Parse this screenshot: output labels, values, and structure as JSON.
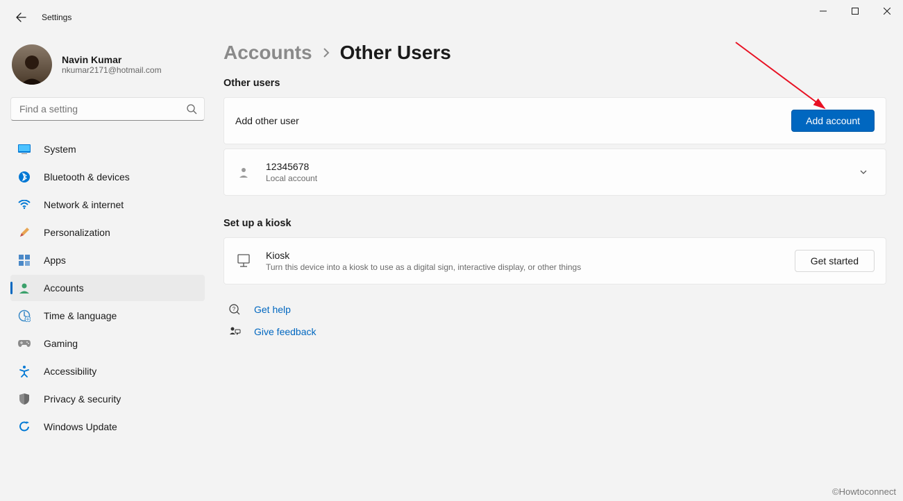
{
  "window": {
    "title": "Settings"
  },
  "user": {
    "name": "Navin Kumar",
    "email": "nkumar2171@hotmail.com"
  },
  "search": {
    "placeholder": "Find a setting"
  },
  "sidebar": {
    "items": [
      {
        "label": "System"
      },
      {
        "label": "Bluetooth & devices"
      },
      {
        "label": "Network & internet"
      },
      {
        "label": "Personalization"
      },
      {
        "label": "Apps"
      },
      {
        "label": "Accounts"
      },
      {
        "label": "Time & language"
      },
      {
        "label": "Gaming"
      },
      {
        "label": "Accessibility"
      },
      {
        "label": "Privacy & security"
      },
      {
        "label": "Windows Update"
      }
    ]
  },
  "breadcrumb": {
    "parent": "Accounts",
    "current": "Other Users"
  },
  "sections": {
    "other_users": {
      "title": "Other users",
      "add_label": "Add other user",
      "add_button": "Add account",
      "account": {
        "name": "12345678",
        "type": "Local account"
      }
    },
    "kiosk": {
      "title": "Set up a kiosk",
      "card_title": "Kiosk",
      "card_sub": "Turn this device into a kiosk to use as a digital sign, interactive display, or other things",
      "button": "Get started"
    }
  },
  "help": {
    "get_help": "Get help",
    "give_feedback": "Give feedback"
  },
  "watermark": "©Howtoconnect"
}
